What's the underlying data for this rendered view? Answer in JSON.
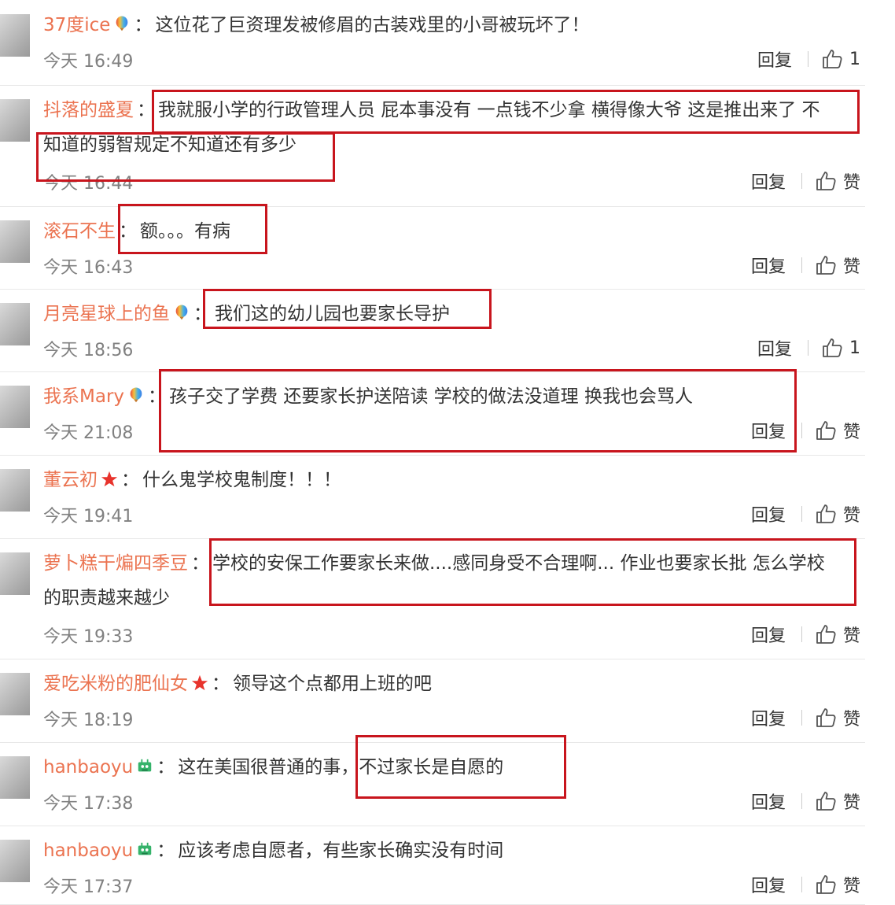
{
  "comments": [
    {
      "user": "37度ice",
      "badge": "balloon-icon",
      "text": "这位花了巨资理发被修眉的古装戏里的小哥被玩坏了！",
      "text2": "",
      "time": "今天 16:49",
      "reply": "回复",
      "like": "1"
    },
    {
      "user": "抖落的盛夏",
      "badge": "",
      "text": "我就服小学的行政管理人员 屁本事没有 一点钱不少拿 横得像大爷 这是推出来了 不",
      "text2": "知道的弱智规定不知道还有多少",
      "time": "今天 16:44",
      "reply": "回复",
      "like": "赞"
    },
    {
      "user": "滚石不生",
      "badge": "",
      "text": "额。。。有病",
      "text2": "",
      "time": "今天 16:43",
      "reply": "回复",
      "like": "赞"
    },
    {
      "user": "月亮星球上的鱼",
      "badge": "balloon-icon",
      "text": "我们这的幼儿园也要家长导护",
      "text2": "",
      "time": "今天 18:56",
      "reply": "回复",
      "like": "1"
    },
    {
      "user": "我系Mary",
      "badge": "balloon-icon",
      "text": "孩子交了学费 还要家长护送陪读 学校的做法没道理 换我也会骂人",
      "text2": "",
      "time": "今天 21:08",
      "reply": "回复",
      "like": "赞"
    },
    {
      "user": "董云初",
      "badge": "star-icon",
      "text": "什么鬼学校鬼制度！！！",
      "text2": "",
      "time": "今天 19:41",
      "reply": "回复",
      "like": "赞"
    },
    {
      "user": "萝卜糕干煸四季豆",
      "badge": "",
      "text": "学校的安保工作要家长来做....感同身受不合理啊... 作业也要家长批 怎么学校",
      "text2": "的职责越来越少",
      "time": "今天 19:33",
      "reply": "回复",
      "like": "赞"
    },
    {
      "user": "爱吃米粉的肥仙女",
      "badge": "star-icon",
      "text": "领导这个点都用上班的吧",
      "text2": "",
      "time": "今天 18:19",
      "reply": "回复",
      "like": "赞"
    },
    {
      "user": "hanbaoyu",
      "badge": "robot-icon",
      "text": "这在美国很普通的事，不过家长是自愿的",
      "text2": "",
      "time": "今天 17:38",
      "reply": "回复",
      "like": "赞"
    },
    {
      "user": "hanbaoyu",
      "badge": "robot-icon",
      "text": "应该考虑自愿者，有些家长确实没有时间",
      "text2": "",
      "time": "今天 17:37",
      "reply": "回复",
      "like": "赞"
    }
  ],
  "colors": {
    "username": "#eb7350",
    "highlight_box": "#c8151d",
    "timestamp": "#808080",
    "divider": "#e8e8e8"
  }
}
